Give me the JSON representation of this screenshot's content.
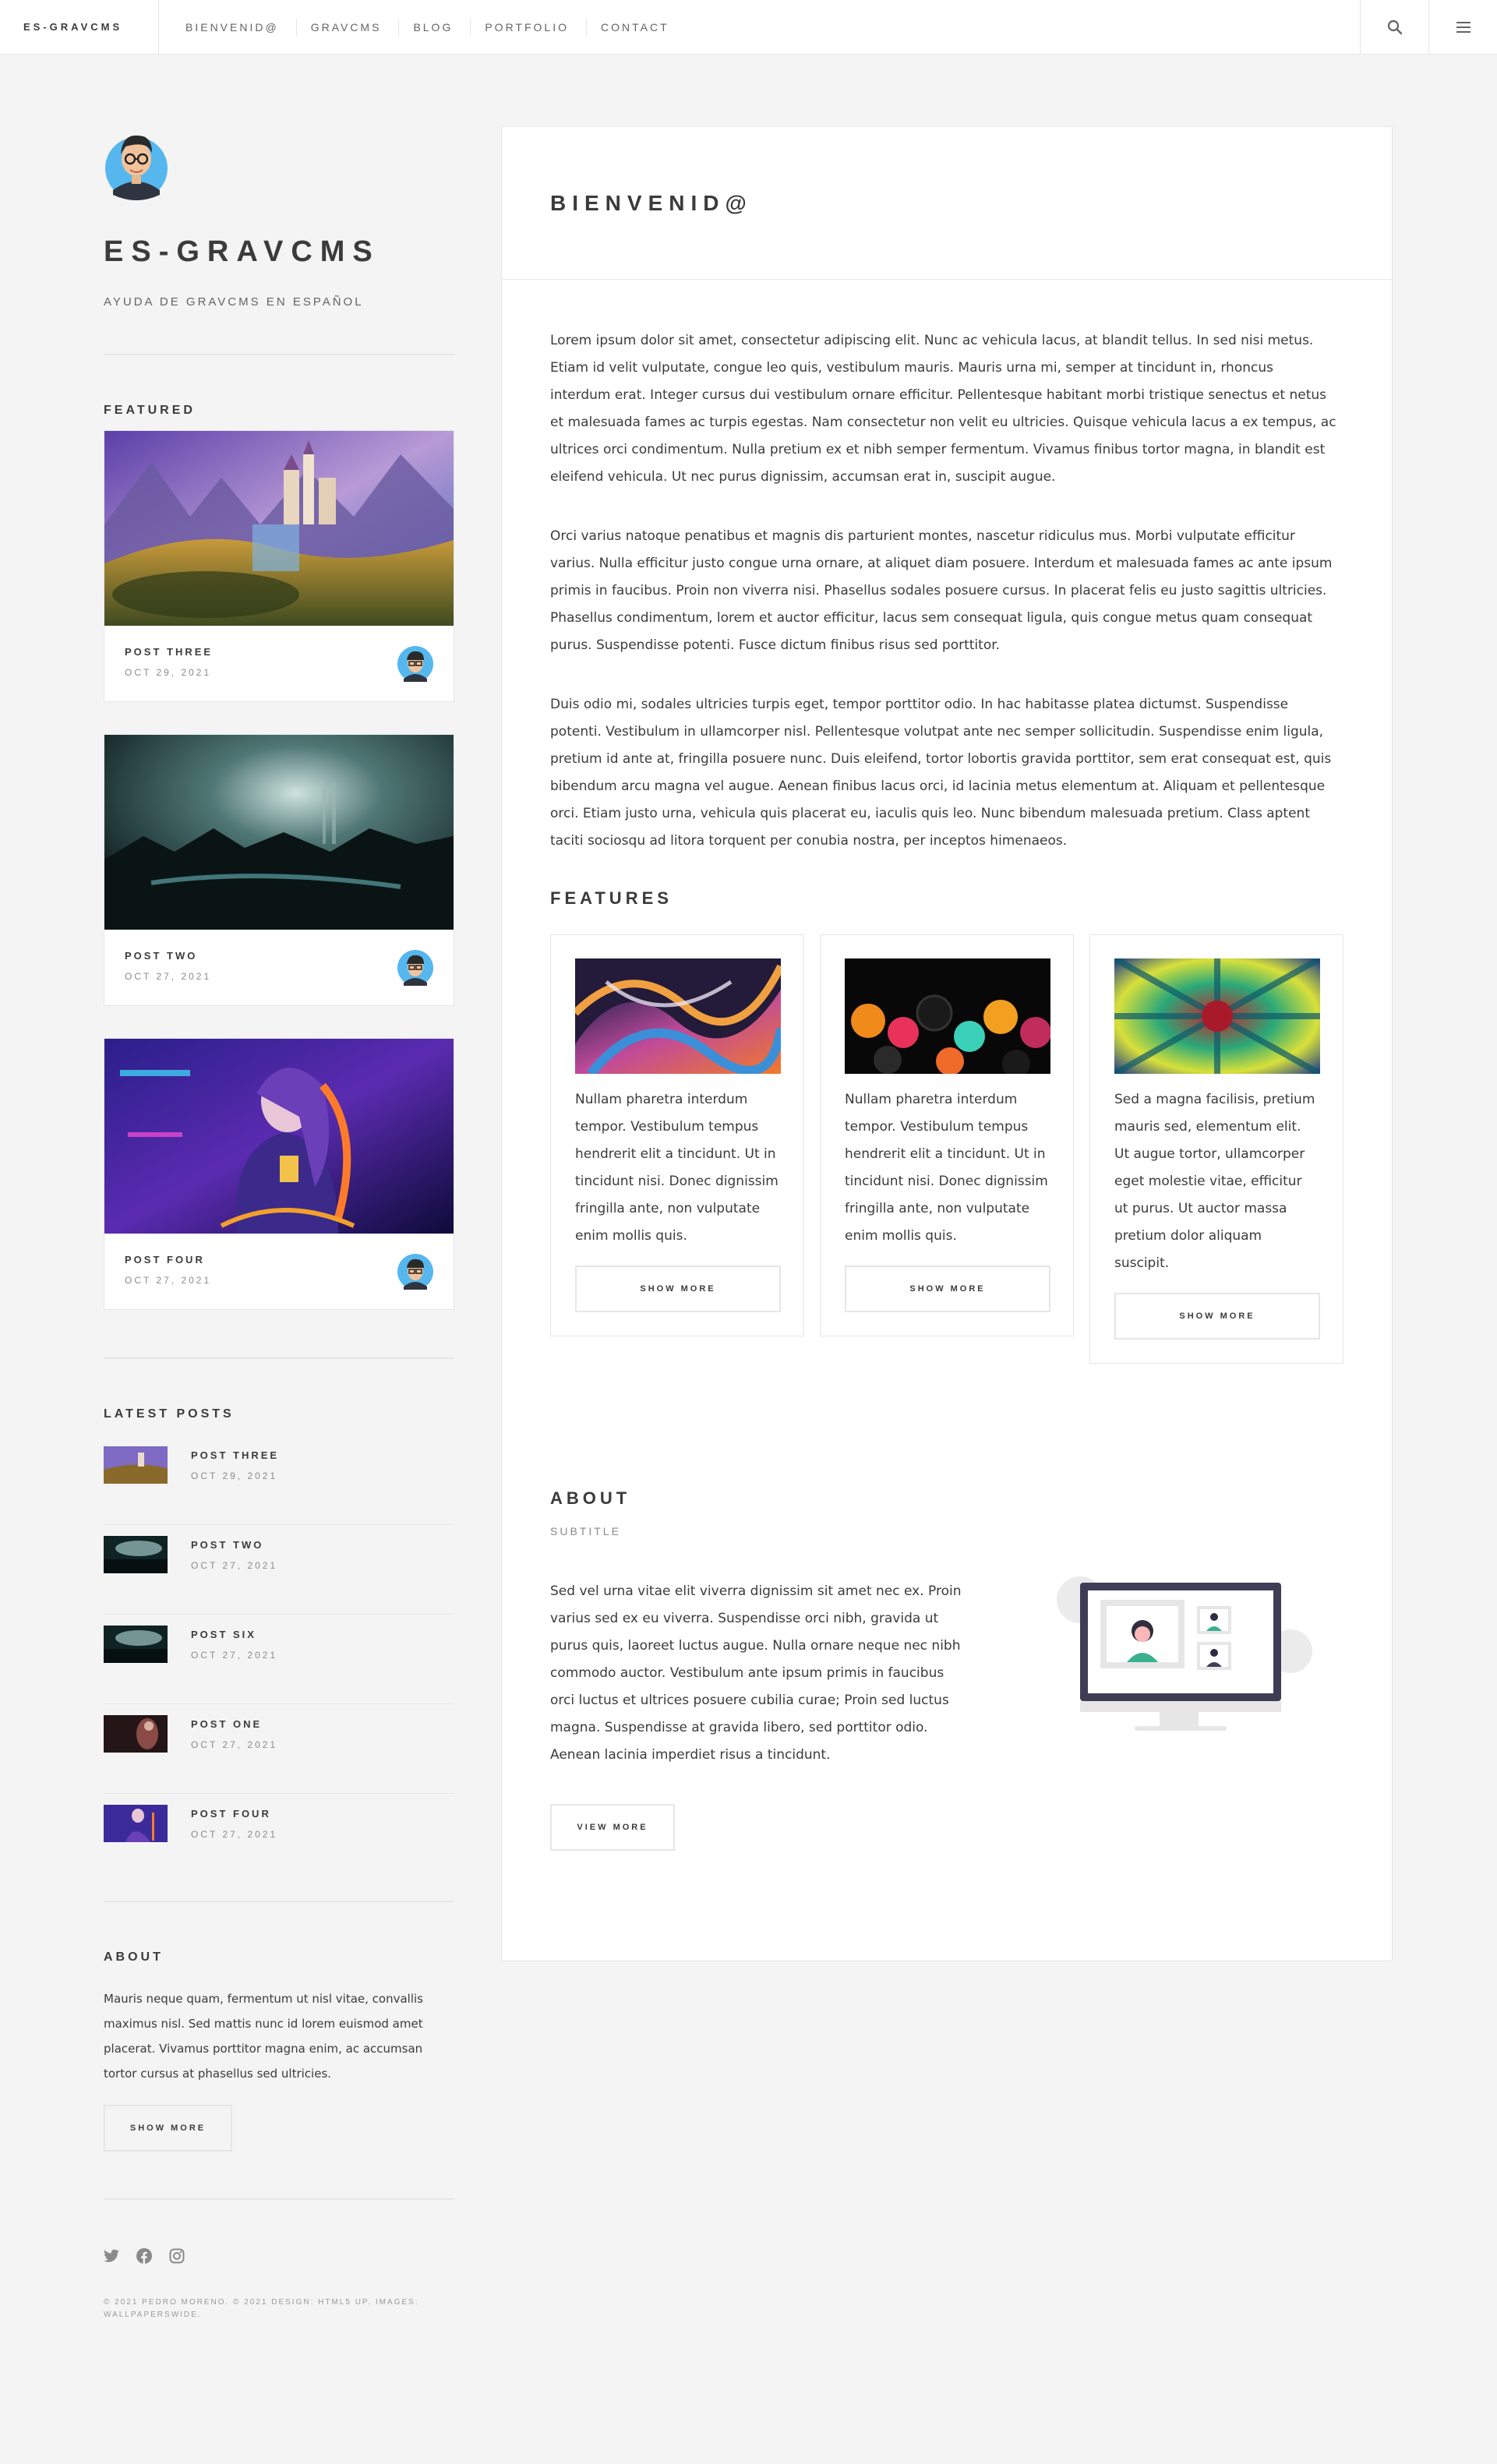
{
  "header": {
    "brand": "ES-GRAVCMS",
    "nav": [
      "BIENVENID@",
      "GRAVCMS",
      "BLOG",
      "PORTFOLIO",
      "CONTACT"
    ],
    "search_icon": "search-icon",
    "menu_icon": "hamburger-menu-icon"
  },
  "sidebar": {
    "avatar_icon": "avatar-glasses-icon",
    "title": "ES-GRAVCMS",
    "subtitle": "AYUDA DE GRAVCMS EN ESPAÑOL",
    "featured_heading": "FEATURED",
    "featured": [
      {
        "title": "POST THREE",
        "date": "OCT 29, 2021"
      },
      {
        "title": "POST TWO",
        "date": "OCT 27, 2021"
      },
      {
        "title": "POST FOUR",
        "date": "OCT 27, 2021"
      }
    ],
    "latest_heading": "LATEST POSTS",
    "latest": [
      {
        "title": "POST THREE",
        "date": "OCT 29, 2021"
      },
      {
        "title": "POST TWO",
        "date": "OCT 27, 2021"
      },
      {
        "title": "POST SIX",
        "date": "OCT 27, 2021"
      },
      {
        "title": "POST ONE",
        "date": "OCT 27, 2021"
      },
      {
        "title": "POST FOUR",
        "date": "OCT 27, 2021"
      }
    ],
    "about_heading": "ABOUT",
    "about_text": "Mauris neque quam, fermentum ut nisl vitae, convallis maximus nisl. Sed mattis nunc id lorem euismod amet placerat. Vivamus porttitor magna enim, ac accumsan tortor cursus at phasellus sed ultricies.",
    "about_button": "SHOW MORE",
    "social_icons": [
      "twitter-icon",
      "facebook-icon",
      "instagram-icon"
    ],
    "copyright": "© 2021 PEDRO MORENO. © 2021 DESIGN: HTML5 UP. IMAGES: WALLPAPERSWIDE."
  },
  "main": {
    "title": "BIENVENID@",
    "paragraphs": [
      "Lorem ipsum dolor sit amet, consectetur adipiscing elit. Nunc ac vehicula lacus, at blandit tellus. In sed nisi metus. Etiam id velit vulputate, congue leo quis, vestibulum mauris. Mauris urna mi, semper at tincidunt in, rhoncus interdum erat. Integer cursus dui vestibulum ornare efficitur. Pellentesque habitant morbi tristique senectus et netus et malesuada fames ac turpis egestas. Nam consectetur non velit eu ultricies. Quisque vehicula lacus a ex tempus, ac ultrices orci condimentum. Nulla pretium ex et nibh semper fermentum. Vivamus finibus tortor magna, in blandit est eleifend vehicula. Ut nec purus dignissim, accumsan erat in, suscipit augue.",
      "Orci varius natoque penatibus et magnis dis parturient montes, nascetur ridiculus mus. Morbi vulputate efficitur varius. Nulla efficitur justo congue urna ornare, at aliquet diam posuere. Interdum et malesuada fames ac ante ipsum primis in faucibus. Proin non viverra nisi. Phasellus sodales posuere cursus. In placerat felis eu justo sagittis ultricies. Phasellus condimentum, lorem et auctor efficitur, lacus sem consequat ligula, quis congue metus quam consequat purus. Suspendisse potenti. Fusce dictum finibus risus sed porttitor.",
      "Duis odio mi, sodales ultricies turpis eget, tempor porttitor odio. In hac habitasse platea dictumst. Suspendisse potenti. Vestibulum in ullamcorper nisl. Pellentesque volutpat ante nec semper sollicitudin. Suspendisse enim ligula, pretium id ante at, fringilla posuere nunc. Duis eleifend, tortor lobortis gravida porttitor, sem erat consequat est, quis bibendum arcu magna vel augue. Aenean finibus lacus orci, id lacinia metus elementum at. Aliquam et pellentesque orci. Etiam justo urna, vehicula quis placerat eu, iaculis quis leo. Nunc bibendum malesuada pretium. Class aptent taciti sociosqu ad litora torquent per conubia nostra, per inceptos himenaeos."
    ],
    "features_heading": "FEATURES",
    "features": [
      {
        "text": "Nullam pharetra interdum tempor. Vestibulum tempus hendrerit elit a tincidunt. Ut in tincidunt nisi. Donec dignissim fringilla ante, non vulputate enim mollis quis.",
        "button": "SHOW MORE"
      },
      {
        "text": "Nullam pharetra interdum tempor. Vestibulum tempus hendrerit elit a tincidunt. Ut in tincidunt nisi. Donec dignissim fringilla ante, non vulputate enim mollis quis.",
        "button": "SHOW MORE"
      },
      {
        "text": "Sed a magna facilisis, pretium mauris sed, elementum elit. Ut augue tortor, ullamcorper eget molestie vitae, efficitur ut purus. Ut auctor massa pretium dolor aliquam suscipit.",
        "button": "SHOW MORE"
      }
    ],
    "about_heading": "ABOUT",
    "about_subtitle": "SUBTITLE",
    "about_text": "Sed vel urna vitae elit viverra dignissim sit amet nec ex. Proin varius sed ex eu viverra. Suspendisse orci nibh, gravida ut purus quis, laoreet luctus augue. Nulla ornare neque nec nibh commodo auctor. Vestibulum ante ipsum primis in faucibus orci luctus et ultrices posuere cubilia curae; Proin sed luctus magna. Suspendisse at gravida libero, sed porttitor odio. Aenean lacinia imperdiet risus a tincidunt.",
    "about_button": "VIEW MORE",
    "about_illustration": "video-call-monitor-illustration"
  },
  "colors": {
    "background": "#f4f4f4",
    "text": "#3c3b3b",
    "border": "#e6e6e6",
    "panel": "#ffffff"
  }
}
